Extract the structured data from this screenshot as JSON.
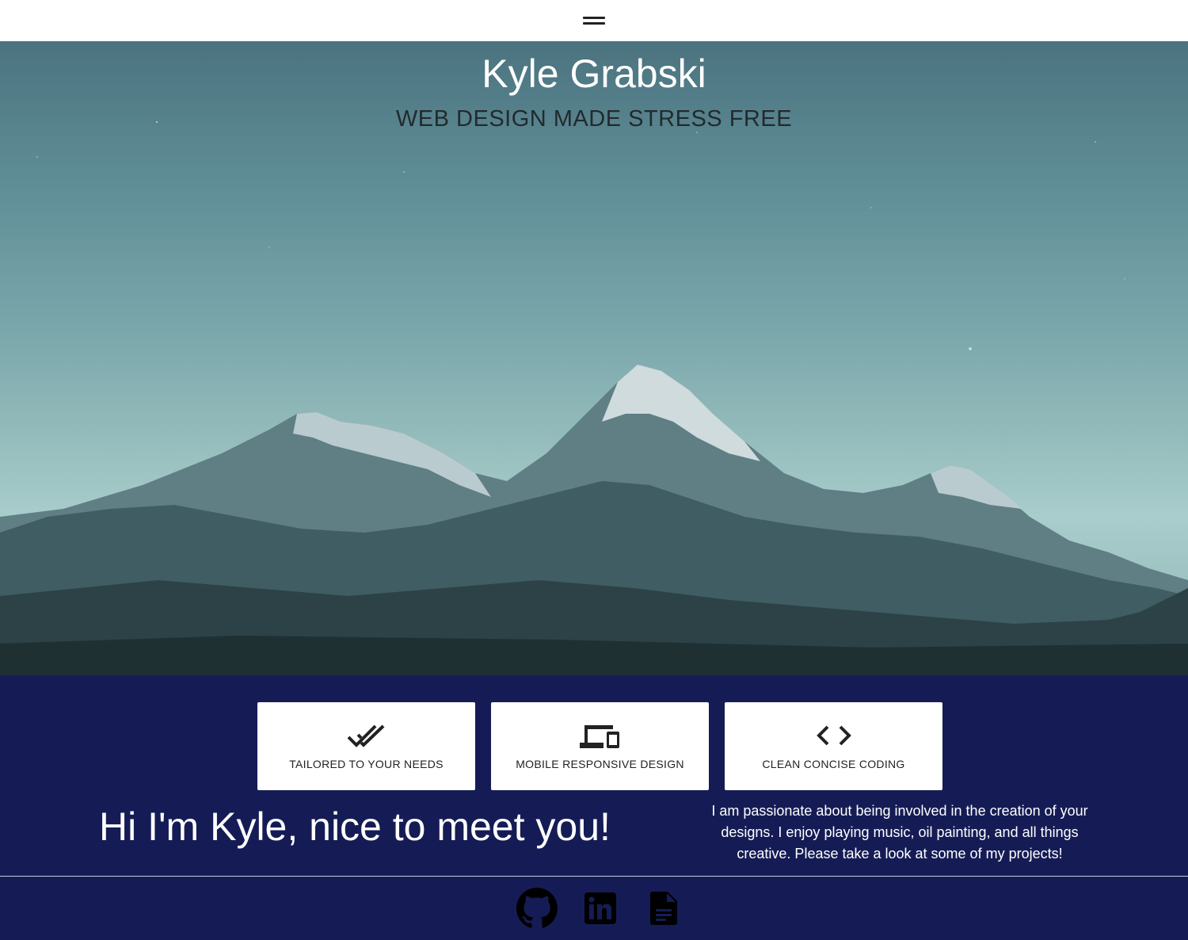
{
  "nav": {
    "menu_icon": "hamburger-menu-icon"
  },
  "hero": {
    "title": "Kyle Grabski",
    "subtitle": "WEB DESIGN MADE STRESS FREE"
  },
  "features": [
    {
      "icon": "double-check-icon",
      "label": "TAILORED TO YOUR NEEDS"
    },
    {
      "icon": "devices-icon",
      "label": "MOBILE RESPONSIVE DESIGN"
    },
    {
      "icon": "code-icon",
      "label": "CLEAN CONCISE CODING"
    }
  ],
  "intro": {
    "greeting": "Hi I'm Kyle, nice to meet you!",
    "about": "I am passionate about being involved in the creation of your designs. I enjoy playing music, oil painting, and all things creative. Please take a look at some of my projects!"
  },
  "footer": {
    "links": [
      {
        "icon": "github-icon"
      },
      {
        "icon": "linkedin-icon"
      },
      {
        "icon": "document-icon"
      }
    ]
  },
  "colors": {
    "nav_bg": "#ffffff",
    "section_bg": "#151c55",
    "card_bg": "#ffffff",
    "icon_dark": "#222222"
  }
}
